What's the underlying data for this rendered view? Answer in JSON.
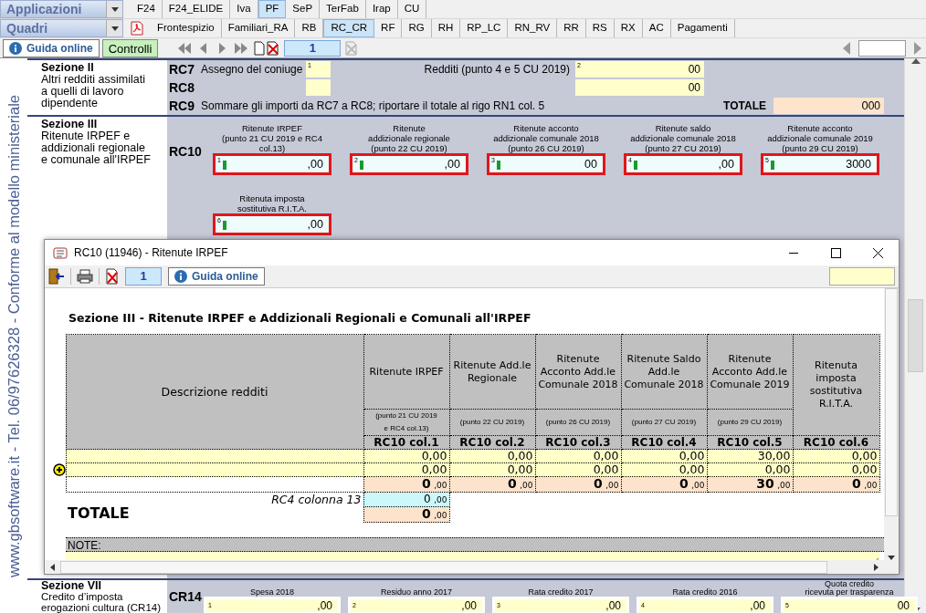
{
  "menus": [
    {
      "label": "Applicazioni"
    },
    {
      "label": "Quadri"
    }
  ],
  "app_tabs": [
    {
      "label": "F24",
      "selected": false
    },
    {
      "label": "F24_ELIDE",
      "selected": false
    },
    {
      "label": "Iva",
      "selected": false
    },
    {
      "label": "PF",
      "selected": true
    },
    {
      "label": "SeP",
      "selected": false
    },
    {
      "label": "TerFab",
      "selected": false
    },
    {
      "label": "Irap",
      "selected": false
    },
    {
      "label": "CU",
      "selected": false
    }
  ],
  "quadri_tabs": [
    {
      "label": "Frontespizio",
      "selected": false
    },
    {
      "label": "Familiari_RA",
      "selected": false
    },
    {
      "label": "RB",
      "selected": false
    },
    {
      "label": "RC_CR",
      "selected": true
    },
    {
      "label": "RF",
      "selected": false
    },
    {
      "label": "RG",
      "selected": false
    },
    {
      "label": "RH",
      "selected": false
    },
    {
      "label": "RP_LC",
      "selected": false
    },
    {
      "label": "RN_RV",
      "selected": false
    },
    {
      "label": "RR",
      "selected": false
    },
    {
      "label": "RS",
      "selected": false
    },
    {
      "label": "RX",
      "selected": false
    },
    {
      "label": "AC",
      "selected": false
    },
    {
      "label": "Pagamenti",
      "selected": false
    }
  ],
  "toolbar": {
    "help_button": "Guida online",
    "check_button": "Controlli",
    "page": "1"
  },
  "side_text": "www.gbsoftware.it - Tel. 06/97626328 - Conforme al modello ministeriale",
  "sezione_ii": {
    "title": "Sezione II",
    "description": "Altri redditi assimilati\na quelli di lavoro\ndipendente",
    "rows": [
      {
        "kind": "fields",
        "code": "RC7",
        "label": "Assegno del coniuge",
        "field_1": {
          "number": "1"
        },
        "mid_label": "Redditi  (punto 4 e 5 CU 2019)",
        "field_2": {
          "number": "2",
          "decimals": "00"
        }
      },
      {
        "kind": "fields",
        "code": "RC8",
        "field_1": {},
        "field_2": {
          "decimals": "00"
        }
      },
      {
        "kind": "total",
        "code": "RC9",
        "label": "Sommare gli importi da RC7 a RC8; riportare il totale al rigo RN1 col. 5",
        "total_label": "TOTALE",
        "total": {
          "value": "0",
          "decimals": "00"
        }
      }
    ]
  },
  "sezione_iii": {
    "title": "Sezione III",
    "description": "Ritenute IRPEF e\naddizionali regionale\ne comunale all'IRPEF",
    "code": "RC10",
    "fields": [
      {
        "label": "Ritenute IRPEF\n(punto 21 CU 2019 e RC4 col.13)",
        "number": "1",
        "decimals": ",00",
        "highlighted": true
      },
      {
        "label": "Ritenute\naddizionale regionale\n(punto 22 CU 2019)",
        "number": "2",
        "decimals": ",00",
        "highlighted": true
      },
      {
        "label": "Ritenute acconto\naddizionale comunale 2018\n(punto 26 CU 2019)",
        "number": "3",
        "decimals": "00",
        "highlighted": true
      },
      {
        "label": "Ritenute saldo\naddizionale comunale 2018\n(punto 27 CU 2019)",
        "number": "4",
        "decimals": ",00",
        "highlighted": true
      },
      {
        "label": "Ritenute acconto\naddizionale comunale 2019\n(punto 29 CU 2019)",
        "number": "5",
        "value": "30",
        "decimals": "00",
        "highlighted": true
      },
      {
        "label": "Ritenuta imposta\nsostitutiva R.I.T.A.",
        "number": "6",
        "decimals": ",00",
        "highlighted": true
      }
    ]
  },
  "sezione_vii": {
    "title": "Sezione VII",
    "description": "Credito d’imposta\nerogazioni cultura (CR14)",
    "code": "CR14",
    "fields": [
      {
        "label": "Spesa 2018",
        "number": "1",
        "decimals": ",00"
      },
      {
        "label": "Residuo anno 2017",
        "number": "2",
        "decimals": ",00"
      },
      {
        "label": "Rata credito 2017",
        "number": "3",
        "decimals": ",00"
      },
      {
        "label": "Rata credito 2016",
        "number": "4",
        "decimals": ",00"
      },
      {
        "label": "Quota credito\nricevuta per trasparenza",
        "number": "5",
        "decimals": "00"
      }
    ]
  },
  "dialog": {
    "title": "RC10 (11946) - Ritenute IRPEF",
    "page": "1",
    "help_button": "Guida online",
    "heading": "Sezione III - Ritenute IRPEF e Addizionali Regionali e Comunali all'IRPEF",
    "table": {
      "description_header": "Descrizione redditi",
      "columns": [
        {
          "title": "Ritenute IRPEF",
          "note": "(punto 21   CU 2019\ne RC4 col.13)",
          "code": "RC10 col.1"
        },
        {
          "title": "Ritenute Add.le Regionale",
          "note": "(punto 22 CU 2019)",
          "code": "RC10 col.2"
        },
        {
          "title": "Ritenute Acconto Add.le Comunale 2018",
          "note": "(punto 26 CU 2019)",
          "code": "RC10 col.3"
        },
        {
          "title": "Ritenute Saldo Add.le Comunale 2018",
          "note": "(punto 27 CU 2019)",
          "code": "RC10 col.4"
        },
        {
          "title": "Ritenute Acconto Add.le Comunale 2019",
          "note": "(punto 29 CU 2019)",
          "code": "RC10 col.5"
        },
        {
          "title": "Ritenuta imposta sostitutiva R.I.T.A.",
          "code": "RC10 col.6"
        }
      ],
      "rows": [
        {
          "selected": false,
          "values": [
            "0,00",
            "0,00",
            "0,00",
            "0,00",
            "30,00",
            "0,00"
          ]
        },
        {
          "selected": true,
          "values": [
            "0,00",
            "0,00",
            "0,00",
            "0,00",
            "0,00",
            "0,00"
          ]
        }
      ],
      "totals": [
        {
          "value": "0",
          "decimals": ",00"
        },
        {
          "value": "0",
          "decimals": ",00"
        },
        {
          "value": "0",
          "decimals": ",00"
        },
        {
          "value": "0",
          "decimals": ",00"
        },
        {
          "value": "30",
          "decimals": ",00"
        },
        {
          "value": "0",
          "decimals": ",00"
        }
      ],
      "rc4": {
        "label": "RC4 colonna 13",
        "value": "0",
        "decimals": ",00"
      },
      "total": {
        "label": "TOTALE",
        "value": "0",
        "decimals": ",00"
      }
    },
    "notes_label": "NOTE:"
  }
}
